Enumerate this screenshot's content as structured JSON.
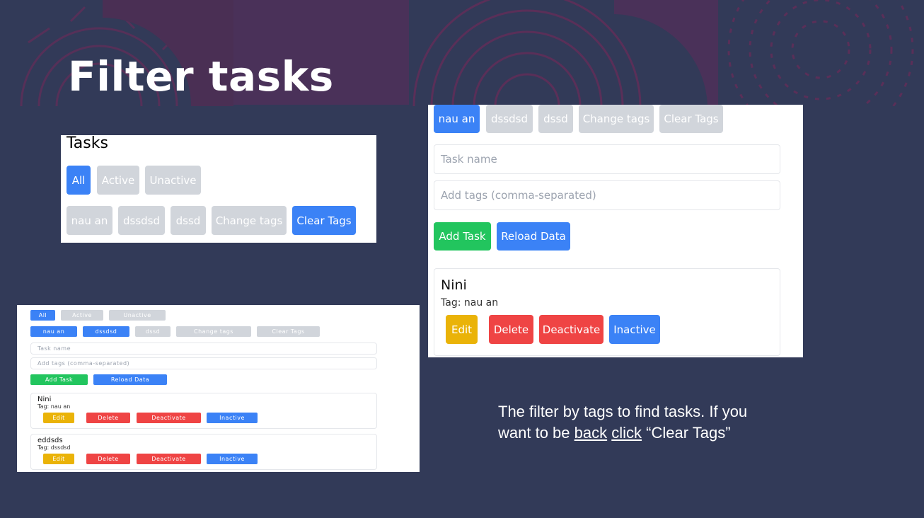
{
  "slide": {
    "title": "Filter tasks",
    "caption": {
      "part1": "The filter by tags to find tasks. If you want to be ",
      "link1": "back",
      "space": " ",
      "link2": "click",
      "part2": " “Clear Tags”"
    }
  },
  "panel1": {
    "heading": "Tasks",
    "filters": [
      "All",
      "Active",
      "Unactive"
    ],
    "tags": [
      "nau an",
      "dssdsd",
      "dssd",
      "Change tags",
      "Clear Tags"
    ]
  },
  "panel2": {
    "tags": [
      "nau an",
      "dssdsd",
      "dssd",
      "Change tags",
      "Clear Tags"
    ],
    "task_name_placeholder": "Task name",
    "tags_placeholder": "Add tags (comma-separated)",
    "add_task": "Add Task",
    "reload_data": "Reload Data",
    "task": {
      "name": "Nini",
      "tag": "Tag: nau an",
      "edit": "Edit",
      "delete": "Delete",
      "deactivate": "Deactivate",
      "status": "Inactive"
    }
  },
  "panel3": {
    "filters": [
      "All",
      "Active",
      "Unactive"
    ],
    "tags": [
      "nau an",
      "dssdsd",
      "dssd",
      "Change tags",
      "Clear Tags"
    ],
    "task_name_placeholder": "Task name",
    "tags_placeholder": "Add tags (comma-separated)",
    "add_task": "Add Task",
    "reload_data": "Reload Data",
    "tasks": [
      {
        "name": "Nini",
        "tag": "Tag: nau an",
        "edit": "Edit",
        "delete": "Delete",
        "deactivate": "Deactivate",
        "status": "Inactive"
      },
      {
        "name": "eddsds",
        "tag": "Tag: dssdsd",
        "edit": "Edit",
        "delete": "Delete",
        "deactivate": "Deactivate",
        "status": "Inactive"
      }
    ]
  },
  "colors": {
    "background": "#323a58",
    "primary": "#3b82f6",
    "muted": "#d1d5db",
    "success": "#22c55e",
    "danger": "#ef4444",
    "warning": "#eab308",
    "decoration": "#6b2f5a"
  }
}
